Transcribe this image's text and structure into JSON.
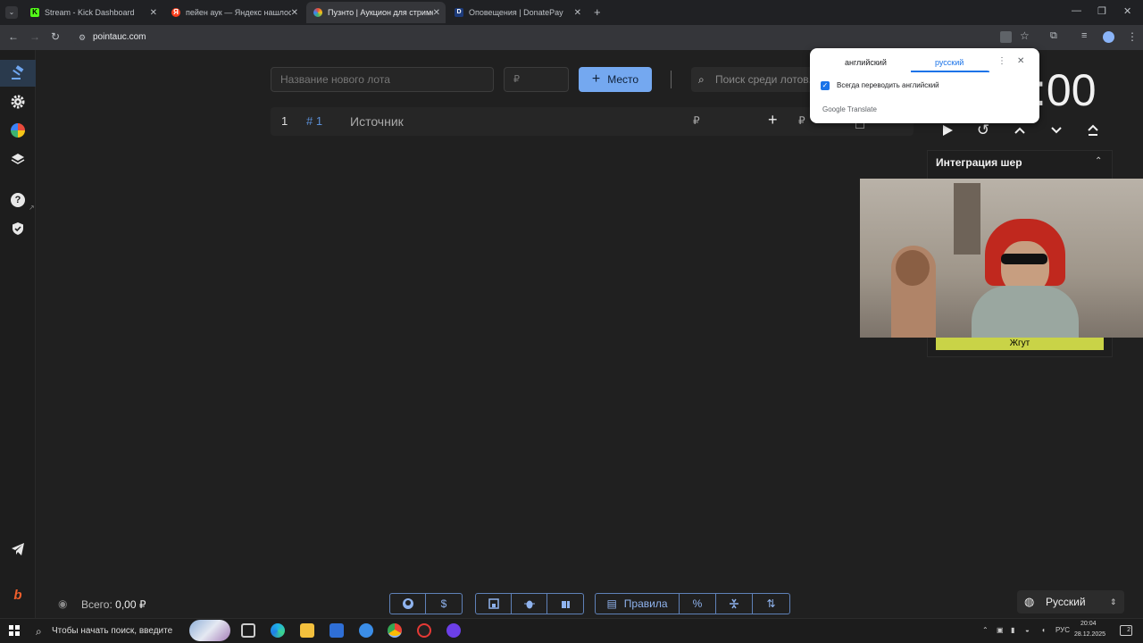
{
  "browser": {
    "tabs": [
      {
        "title": "Stream - Kick Dashboard",
        "active": false
      },
      {
        "title": "пейен аук — Яндекс нашлось",
        "active": false
      },
      {
        "title": "Пузнто | Аукцион для стримера",
        "active": true
      },
      {
        "title": "Оповещения | DonatePay",
        "active": false
      }
    ],
    "new_tab": "+",
    "url": "pointauc.com"
  },
  "toolbar": {
    "lot_name_placeholder": "Название нового лота",
    "amount_placeholder": "₽",
    "place_button": "Место",
    "search_placeholder": "Поиск среди лотов..."
  },
  "lot_row": {
    "index": "1",
    "id": "# 1",
    "source": "Источник",
    "currency": "₽",
    "currency2": "₽"
  },
  "timer": {
    "display": ":00"
  },
  "integration": {
    "title": "Интеграция шер",
    "bar_label": "Жгут"
  },
  "translate_popup": {
    "lang_from": "английский",
    "lang_to": "русский",
    "always_translate": "Всегда переводить английский",
    "brand": "Google Translate"
  },
  "footer": {
    "total_label": "Всего:",
    "total_value": "0,00 ₽",
    "rules_button": "Правила",
    "language": "Русский"
  },
  "taskbar": {
    "search_placeholder": "Чтобы начать поиск, введите",
    "lang_indicator": "РУС",
    "time": "20:04",
    "date": "28.12.2025",
    "notifications": "2"
  },
  "colors": {
    "accent": "#74a8f0",
    "page_bg": "#202020",
    "active_nav_bg": "#2a3a4d"
  }
}
